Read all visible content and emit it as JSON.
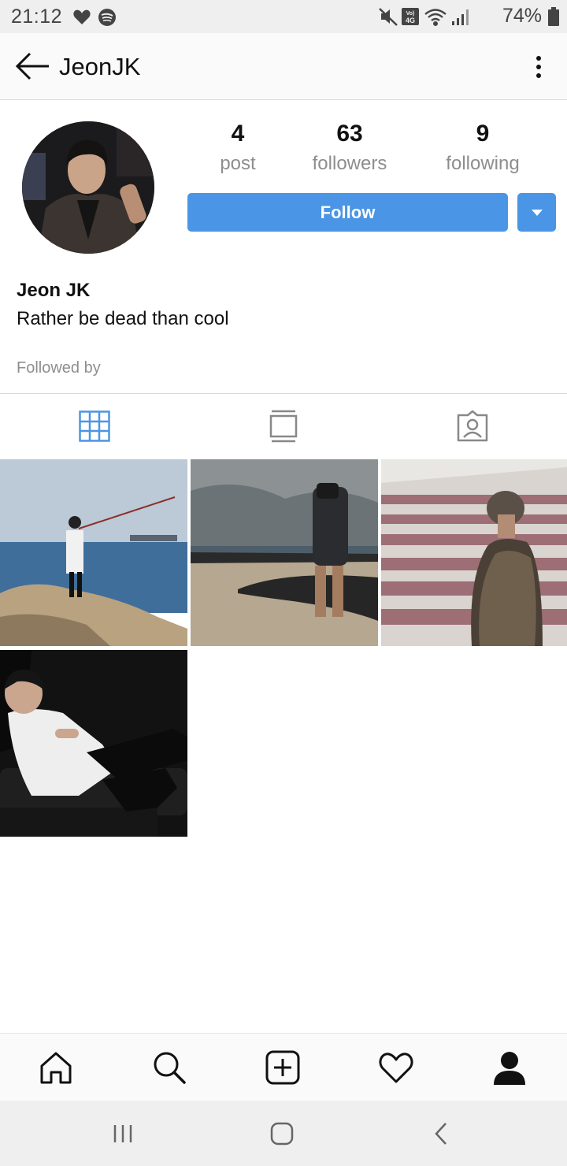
{
  "status_bar": {
    "time": "21:12",
    "battery": "74%",
    "network_badge": "Vo) 4G",
    "icons": [
      "heart-icon",
      "spotify-icon",
      "mute-icon",
      "volte-icon",
      "wifi-icon",
      "signal-icon",
      "battery-icon"
    ]
  },
  "header": {
    "username": "JeonJK",
    "back_icon": "back-arrow-icon",
    "more_icon": "more-vertical-icon"
  },
  "profile": {
    "full_name": "Jeon JK",
    "bio": "Rather be dead than cool",
    "followed_by_label": "Followed by",
    "stats": {
      "posts": {
        "count": "4",
        "label": "post"
      },
      "followers": {
        "count": "63",
        "label": "followers"
      },
      "following": {
        "count": "9",
        "label": "following"
      }
    },
    "follow_button": "Follow"
  },
  "tabs": [
    {
      "icon": "grid-icon",
      "active": true
    },
    {
      "icon": "feed-icon",
      "active": false
    },
    {
      "icon": "tagged-icon",
      "active": false
    }
  ],
  "posts": [
    {
      "icon": "photo-fishing-on-rocks"
    },
    {
      "icon": "photo-beach-rocks"
    },
    {
      "icon": "photo-stadium-seats"
    },
    {
      "icon": "photo-on-sofa"
    }
  ],
  "bottom_nav": [
    "home-icon",
    "search-icon",
    "add-post-icon",
    "activity-heart-icon",
    "profile-icon"
  ],
  "system_nav": [
    "recent-apps-icon",
    "home-button-icon",
    "system-back-icon"
  ],
  "colors": {
    "accent": "#4a95e5",
    "muted_text": "#8e8e8e",
    "divider": "#dbdbdb"
  }
}
